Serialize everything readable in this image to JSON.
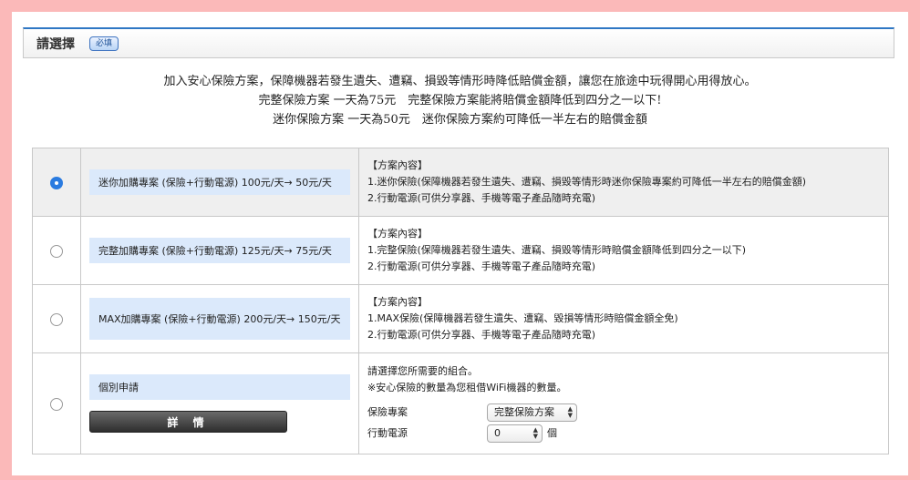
{
  "header": {
    "title": "請選擇",
    "required_badge": "必填"
  },
  "intro": {
    "line1": "加入安心保險方案，保障機器若發生遺失、遭竊、損毀等情形時降低賠償金額，讓您在旅途中玩得開心用得放心。",
    "line2": "完整保險方案 一天為75元　完整保險方案能將賠償金額降低到四分之一以下!",
    "line3": "迷你保險方案 一天為50元　迷你保險方案約可降低一半左右的賠償金額"
  },
  "plans": [
    {
      "label": "迷你加購專案 (保險+行動電源) 100元/天→ 50元/天",
      "selected": true,
      "heading": "【方案內容】",
      "line1": "1.迷你保險(保障機器若發生遺失、遭竊、損毀等情形時迷你保險專案約可降低一半左右的賠償金額)",
      "line2": "2.行動電源(可供分享器、手機等電子產品隨時充電)"
    },
    {
      "label": "完整加購專案 (保險+行動電源) 125元/天→ 75元/天",
      "selected": false,
      "heading": "【方案內容】",
      "line1": "1.完整保險(保障機器若發生遺失、遭竊、損毀等情形時賠償金額降低到四分之一以下)",
      "line2": "2.行動電源(可供分享器、手機等電子產品隨時充電)"
    },
    {
      "label": "MAX加購專案 (保險+行動電源) 200元/天→ 150元/天",
      "selected": false,
      "heading": "【方案內容】",
      "line1": "1.MAX保險(保障機器若發生遺失、遭竊、毀損等情形時賠償金額全免)",
      "line2": "2.行動電源(可供分享器、手機等電子產品隨時充電)"
    }
  ],
  "custom": {
    "label": "個別申請",
    "selected": false,
    "detail_button": "詳 情",
    "note1": "請選擇您所需要的組合。",
    "note2": "※安心保險的數量為您租借WiFi機器的數量。",
    "insurance_label": "保險專案",
    "insurance_value": "完整保險方案",
    "power_label": "行動電源",
    "power_value": "0",
    "power_unit": "個"
  }
}
